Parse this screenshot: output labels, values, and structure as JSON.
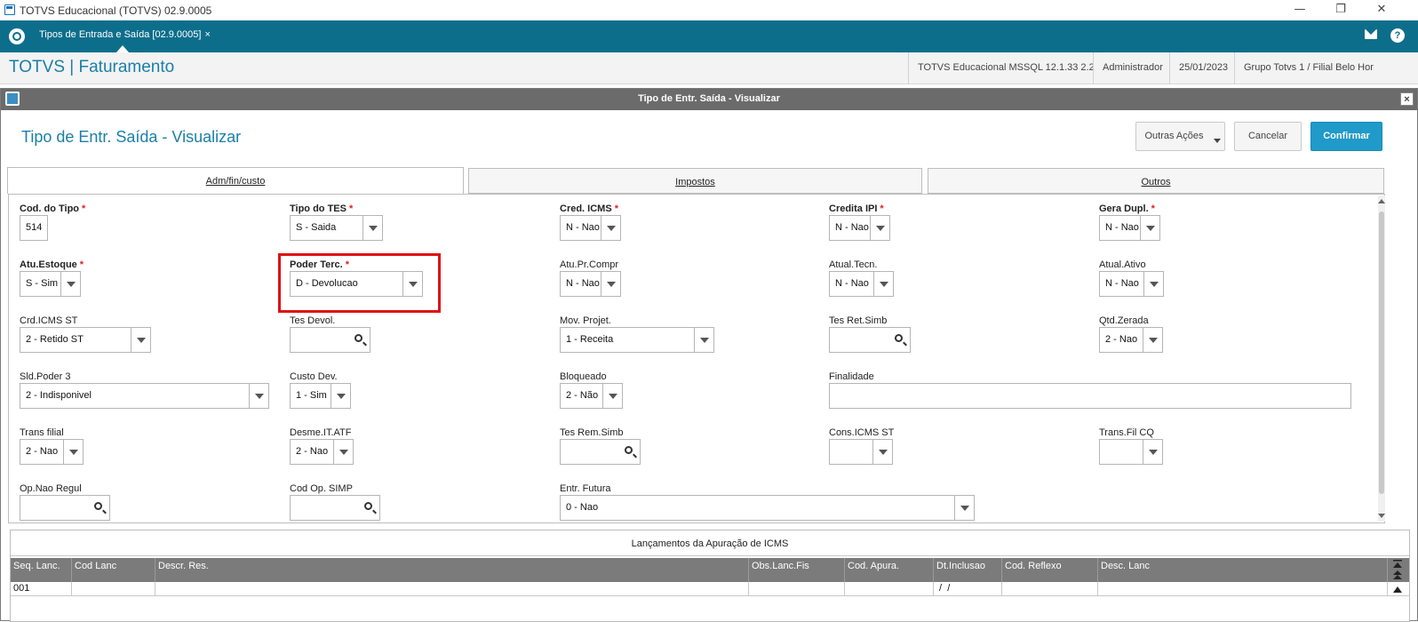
{
  "os_window": {
    "title": "TOTVS Educacional (TOTVS) 02.9.0005",
    "minimize": "—",
    "restore": "❐",
    "close": "✕"
  },
  "tabbar": {
    "tab_label": "Tipos de Entrada e Saída [02.9.0005]",
    "tab_close": "×",
    "help": "?"
  },
  "module_header": {
    "title": "TOTVS | Faturamento",
    "environment": "TOTVS Educacional MSSQL 12.1.33 2.2",
    "user": "Administrador",
    "date": "25/01/2023",
    "branch": "Grupo Totvs 1 / Filial Belo Hor"
  },
  "dialog": {
    "window_title": "Tipo de Entr. Saída - Visualizar",
    "close": "×",
    "heading": "Tipo de Entr. Saída - Visualizar",
    "buttons": {
      "other_actions": "Outras Ações",
      "cancel": "Cancelar",
      "confirm": "Confirmar"
    },
    "tabs": [
      "Adm/fin/custo",
      "Impostos",
      "Outros"
    ],
    "fields": {
      "cod_tipo": {
        "label": "Cod. do Tipo",
        "value": "514"
      },
      "tipo_tes": {
        "label": "Tipo do TES",
        "value": "S - Saida"
      },
      "cred_icms": {
        "label": "Cred. ICMS",
        "value": "N - Nao"
      },
      "credita_ipi": {
        "label": "Credita IPI",
        "value": "N - Nao"
      },
      "gera_dupl": {
        "label": "Gera Dupl.",
        "value": "N - Nao"
      },
      "atu_estoque": {
        "label": "Atu.Estoque",
        "value": "S - Sim"
      },
      "poder_terc": {
        "label": "Poder Terc.",
        "value": "D - Devolucao"
      },
      "atu_pr_compr": {
        "label": "Atu.Pr.Compr",
        "value": "N - Nao"
      },
      "atual_tecn": {
        "label": "Atual.Tecn.",
        "value": "N - Nao"
      },
      "atual_ativo": {
        "label": "Atual.Ativo",
        "value": "N - Nao"
      },
      "crd_icms_st": {
        "label": "Crd.ICMS ST",
        "value": "2 - Retido ST"
      },
      "tes_devol": {
        "label": "Tes Devol.",
        "value": ""
      },
      "mov_projet": {
        "label": "Mov. Projet.",
        "value": "1 - Receita"
      },
      "tes_ret_simb": {
        "label": "Tes Ret.Simb",
        "value": ""
      },
      "qtd_zerada": {
        "label": "Qtd.Zerada",
        "value": "2 - Nao"
      },
      "sld_poder_3": {
        "label": "Sld.Poder 3",
        "value": "2 - Indisponivel"
      },
      "custo_dev": {
        "label": "Custo Dev.",
        "value": "1 - Sim"
      },
      "bloqueado": {
        "label": "Bloqueado",
        "value": "2 - Não"
      },
      "finalidade": {
        "label": "Finalidade",
        "value": ""
      },
      "trans_filial": {
        "label": "Trans filial",
        "value": "2 - Nao"
      },
      "desme_it_atf": {
        "label": "Desme.IT.ATF",
        "value": "2 - Nao"
      },
      "tes_rem_simb": {
        "label": "Tes Rem.Simb",
        "value": ""
      },
      "cons_icms_st": {
        "label": "Cons.ICMS ST",
        "value": ""
      },
      "trans_fil_cq": {
        "label": "Trans.Fil CQ",
        "value": ""
      },
      "op_nao_regul": {
        "label": "Op.Nao Regul",
        "value": ""
      },
      "cod_op_simp": {
        "label": "Cod Op. SIMP",
        "value": ""
      },
      "entr_futura": {
        "label": "Entr. Futura",
        "value": "0 - Nao"
      }
    },
    "icms_grid": {
      "title": "Lançamentos da Apuração de ICMS",
      "columns": [
        "Seq. Lanc.",
        "Cod Lanc",
        "Descr. Res.",
        "Obs.Lanc.Fis",
        "Cod. Apura.",
        "Dt.Inclusao",
        "Cod. Reflexo",
        "Desc. Lanc"
      ],
      "rows": [
        [
          "001",
          "",
          "",
          "",
          "",
          " /  / ",
          "",
          ""
        ]
      ]
    }
  },
  "colors": {
    "teal_bar": "#0d6e8b",
    "accent": "#1a7fa8",
    "confirm": "#1f9ac9",
    "required": "#e02020",
    "highlight": "#e01010",
    "grid_header": "#7b7b7b"
  }
}
